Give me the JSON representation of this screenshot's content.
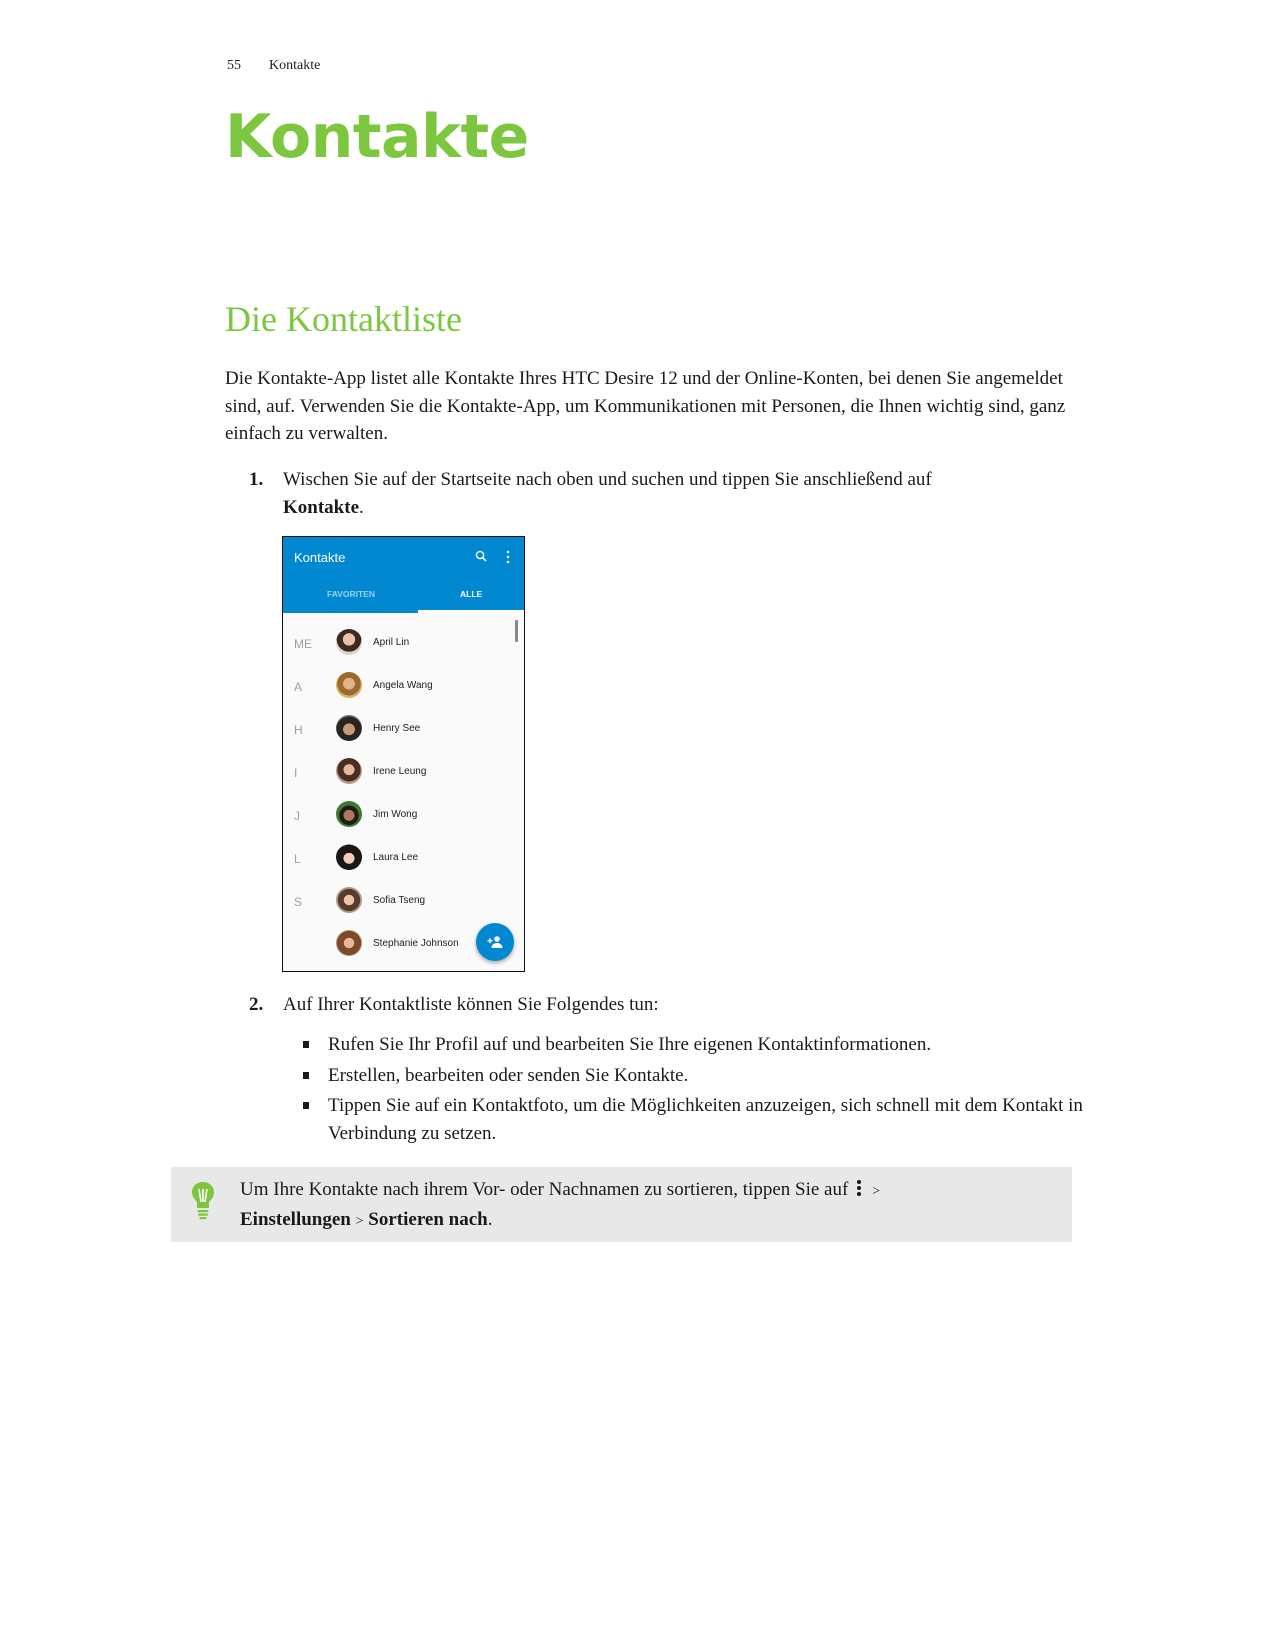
{
  "running_head": {
    "page_number": "55",
    "chapter": "Kontakte"
  },
  "chapter_title": "Kontakte",
  "section_title": "Die Kontaktliste",
  "intro": "Die Kontakte-App listet alle Kontakte Ihres HTC Desire 12 und der Online-Konten, bei denen Sie angemeldet sind, auf. Verwenden Sie die Kontakte-App, um Kommunikationen mit Personen, die Ihnen wichtig sind, ganz einfach zu verwalten.",
  "steps": [
    {
      "number": "1.",
      "text": "Wischen Sie auf der Startseite nach oben und suchen und tippen Sie anschließend auf ",
      "bold": "Kontakte",
      "suffix": "."
    },
    {
      "number": "2.",
      "text": "Auf Ihrer Kontaktliste können Sie Folgendes tun:"
    }
  ],
  "bullets": [
    "Rufen Sie Ihr Profil auf und bearbeiten Sie Ihre eigenen Kontaktinformationen.",
    "Erstellen, bearbeiten oder senden Sie Kontakte.",
    "Tippen Sie auf ein Kontaktfoto, um die Möglichkeiten anzuzeigen, sich schnell mit dem Kontakt in Verbindung zu setzen."
  ],
  "phone": {
    "app_title": "Kontakte",
    "tabs": [
      {
        "label": "FAVORITEN",
        "active": false
      },
      {
        "label": "ALLE",
        "active": true
      }
    ],
    "accent_color": "#0288d1",
    "contacts": [
      {
        "letter": "ME",
        "name": "April Lin"
      },
      {
        "letter": "A",
        "name": "Angela Wang"
      },
      {
        "letter": "H",
        "name": "Henry See"
      },
      {
        "letter": "I",
        "name": "Irene Leung"
      },
      {
        "letter": "J",
        "name": "Jim Wong"
      },
      {
        "letter": "L",
        "name": "Laura Lee"
      },
      {
        "letter": "S",
        "name": "Sofia Tseng"
      },
      {
        "letter": "",
        "name": "Stephanie Johnson"
      }
    ],
    "icons": [
      "search-icon",
      "more-vert-icon",
      "add-contact-icon"
    ]
  },
  "tip": {
    "text_before": "Um Ihre Kontakte nach ihrem Vor- oder Nachnamen zu sortieren, tippen Sie auf",
    "sep1": ">",
    "bold1": "Einstellungen",
    "sep2": ">",
    "bold2": "Sortieren nach",
    "suffix": ".",
    "icon": "lightbulb-icon"
  },
  "colors": {
    "heading_green": "#7dc63f",
    "tip_background": "#e8e8e8"
  }
}
